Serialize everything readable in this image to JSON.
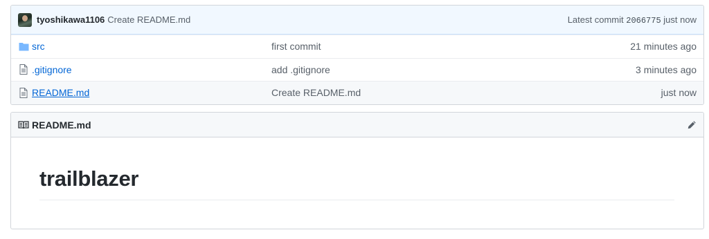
{
  "commit": {
    "author": "tyoshikawa1106",
    "message": "Create README.md",
    "latest_label": "Latest commit",
    "sha": "2066775",
    "time": "just now"
  },
  "files": [
    {
      "name": "src",
      "type": "folder",
      "message": "first commit",
      "age": "21 minutes ago"
    },
    {
      "name": ".gitignore",
      "type": "file",
      "message": "add .gitignore",
      "age": "3 minutes ago"
    },
    {
      "name": "README.md",
      "type": "file",
      "message": "Create README.md",
      "age": "just now"
    }
  ],
  "readme": {
    "filename": "README.md",
    "heading": "trailblazer"
  },
  "icons": {
    "folder": "folder-icon",
    "file": "file-text-icon",
    "book": "book-icon",
    "edit": "pencil-icon"
  },
  "colors": {
    "link": "#0366d6",
    "commit_bar_bg": "#f1f8ff"
  }
}
